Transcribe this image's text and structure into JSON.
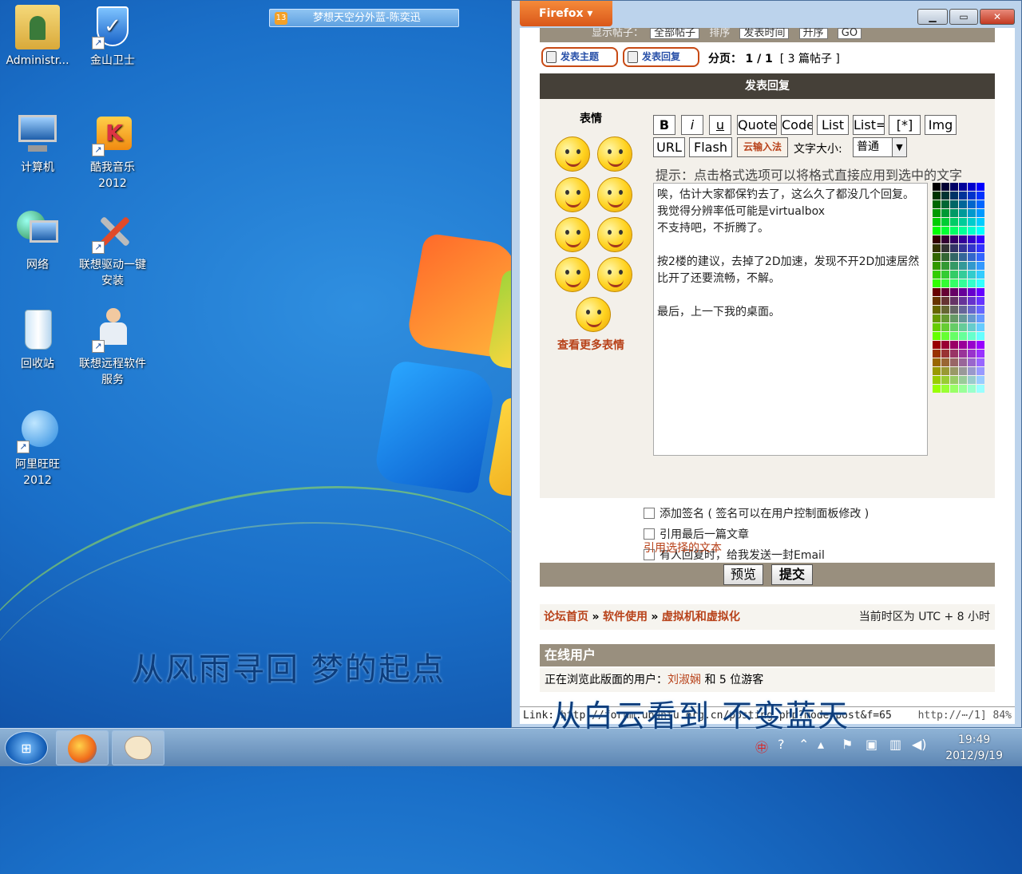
{
  "desktop": {
    "icons": [
      {
        "id": "admin",
        "label": "Administr...",
        "icon": "user-folder-icon"
      },
      {
        "id": "jinshan",
        "label": "金山卫士",
        "icon": "shield-icon"
      },
      {
        "id": "computer",
        "label": "计算机",
        "icon": "computer-icon"
      },
      {
        "id": "kuwo",
        "label": "酷我音乐\n2012",
        "icon": "music-icon"
      },
      {
        "id": "network",
        "label": "网络",
        "icon": "network-icon"
      },
      {
        "id": "lenovo-driver",
        "label": "联想驱动一键\n安装",
        "icon": "tools-icon"
      },
      {
        "id": "recycle",
        "label": "回收站",
        "icon": "recycle-bin-icon"
      },
      {
        "id": "lenovo-remote",
        "label": "联想远程软件\n服务",
        "icon": "support-person-icon"
      },
      {
        "id": "aliwangwang",
        "label": "阿里旺旺\n2012",
        "icon": "chat-bubble-icon"
      }
    ],
    "notification": "梦想天空分外蓝-陈奕迅",
    "notification_badge": "13",
    "slogan_left": "从风雨寻回 梦的起点",
    "slogan_right": "从白云看到 不变蓝天"
  },
  "firefox": {
    "menu_button": "Firefox",
    "controls": {
      "min": "▁",
      "max": "▭",
      "close": "✕"
    },
    "fragment": {
      "label1": "显示帖子：",
      "select1": "全部帖子",
      "label2": "排序",
      "select2": "发表时间",
      "select3": "升序",
      "go": "GO"
    },
    "buttons": {
      "new_topic": "发表主题",
      "reply": "发表回复"
    },
    "pagination": {
      "label": "分页：",
      "value": "1 / 1",
      "count": "[ 3 篇帖子 ]"
    },
    "reply_header": "发表回复",
    "emoticons_title": "表情",
    "more_emoticons": "查看更多表情",
    "toolbar": {
      "bold": "B",
      "italic": "i",
      "underline": "u",
      "quote": "Quote",
      "code": "Code",
      "list": "List",
      "list_ordered": "List=",
      "list_item": "[*]",
      "img": "Img",
      "url": "URL",
      "flash": "Flash",
      "ime": "云输入法",
      "font_size_label": "文字大小:",
      "font_size_value": "普通"
    },
    "hint": "提示：点击格式选项可以将格式直接应用到选中的文字",
    "message": "唉，估计大家都保钓去了，这么久了都没几个回复。我觉得分辨率低可能是virtualbox\n不支持吧，不折腾了。\n\n按2楼的建议，去掉了2D加速，发现不开2D加速居然比开了还要流畅，不解。\n\n最后，上一下我的桌面。",
    "options": [
      {
        "label": "添加签名 ( 签名可以在用户控制面板修改 )",
        "checked": false
      },
      {
        "label": "引用最后一篇文章",
        "checked": false
      },
      {
        "label": "有人回复时，给我发送一封Email",
        "checked": false
      }
    ],
    "quote_selected": "引用选择的文本",
    "preview": "预览",
    "submit": "提交",
    "breadcrumb": {
      "home": "论坛首页",
      "sep": "»",
      "cat": "软件使用",
      "sub": "虚拟机和虚拟化"
    },
    "timezone": "当前时区为 UTC + 8 小时",
    "online_header": "在线用户",
    "online_text": "正在浏览此版面的用户：",
    "online_user": "刘淑娴",
    "online_guests": "和 5 位游客",
    "status_link": "Link: http://forum.ubuntu.org.cn/posting.php?mode=post&f=65",
    "status_right": "http://⋯/1] 84%"
  },
  "taskbar": {
    "time": "19:49",
    "date": "2012/9/19"
  },
  "colors": {
    "accent": "#b8421a",
    "header_dark": "#454038",
    "bar_tan": "#998f7e"
  }
}
